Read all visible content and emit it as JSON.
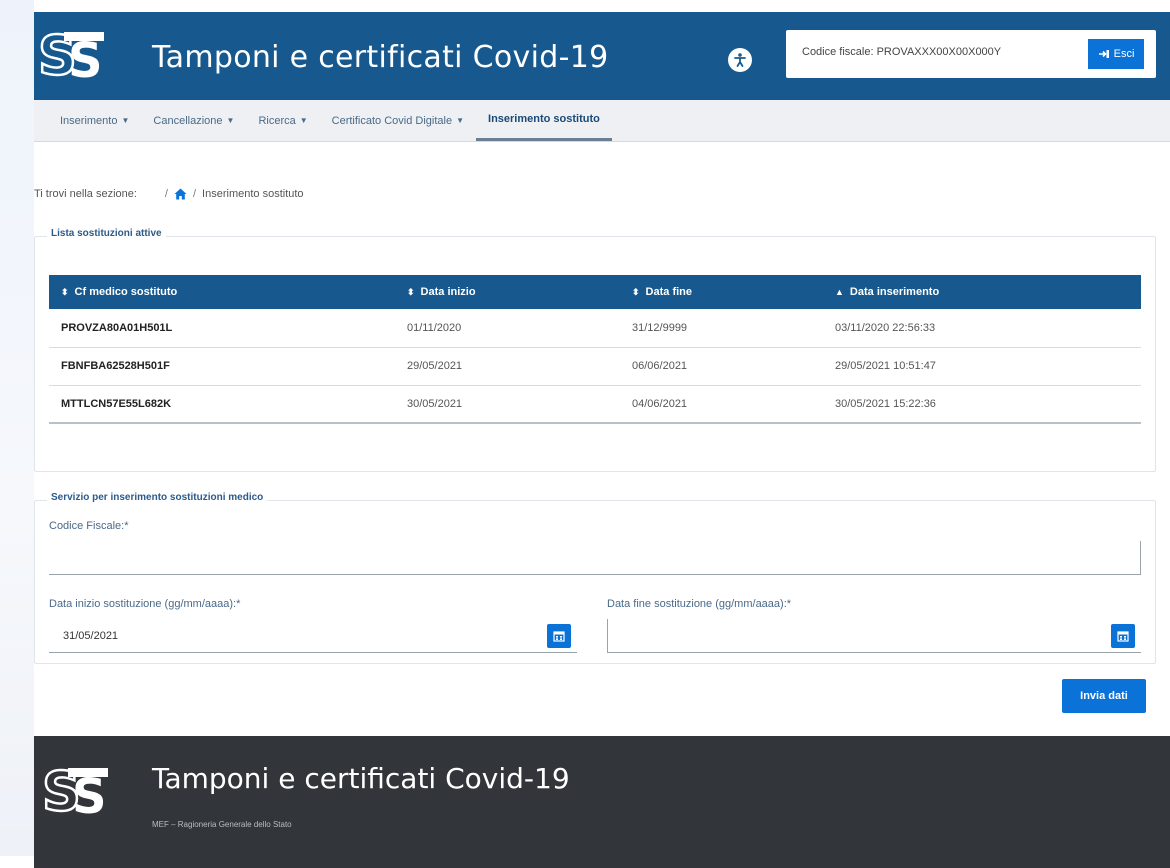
{
  "header": {
    "title": "Tamponi e certificati Covid-19",
    "user_code": "Codice fiscale: PROVAXXX00X00X000Y",
    "exit_label": "Esci"
  },
  "nav": {
    "items": [
      {
        "label": "Inserimento",
        "caret": true
      },
      {
        "label": "Cancellazione",
        "caret": true
      },
      {
        "label": "Ricerca",
        "caret": true
      },
      {
        "label": "Certificato Covid Digitale",
        "caret": true
      },
      {
        "label": "Inserimento sostituto",
        "caret": false,
        "active": true
      }
    ]
  },
  "breadcrumb": {
    "prefix": "Ti trovi nella sezione:",
    "current": "Inserimento sostituto"
  },
  "list": {
    "legend": "Lista sostituzioni attive",
    "columns": [
      "Cf medico sostituto",
      "Data inizio",
      "Data fine",
      "Data inserimento"
    ],
    "rows": [
      {
        "cf": "PROVZA80A01H501L",
        "start": "01/11/2020",
        "end": "31/12/9999",
        "inserted": "03/11/2020 22:56:33"
      },
      {
        "cf": "FBNFBA62528H501F",
        "start": "29/05/2021",
        "end": "06/06/2021",
        "inserted": "29/05/2021 10:51:47"
      },
      {
        "cf": "MTTLCN57E55L682K",
        "start": "30/05/2021",
        "end": "04/06/2021",
        "inserted": "30/05/2021 15:22:36"
      }
    ]
  },
  "form": {
    "legend": "Servizio per inserimento sostituzioni medico",
    "cf_label": "Codice Fiscale:*",
    "cf_value": "",
    "start_label": "Data inizio sostituzione (gg/mm/aaaa):*",
    "start_value": "31/05/2021",
    "end_label": "Data fine sostituzione (gg/mm/aaaa):*",
    "end_value": "",
    "submit_label": "Invia dati"
  },
  "footer": {
    "title": "Tamponi e certificati Covid-19",
    "subtitle": "MEF – Ragioneria Generale dello Stato"
  },
  "colors": {
    "brand": "#17598f",
    "accent": "#0b73d7",
    "footer": "#323539"
  },
  "icons": [
    "sts-logo-icon",
    "accessibility-icon",
    "logout-icon",
    "home-icon",
    "sort-icon",
    "calendar-icon"
  ]
}
